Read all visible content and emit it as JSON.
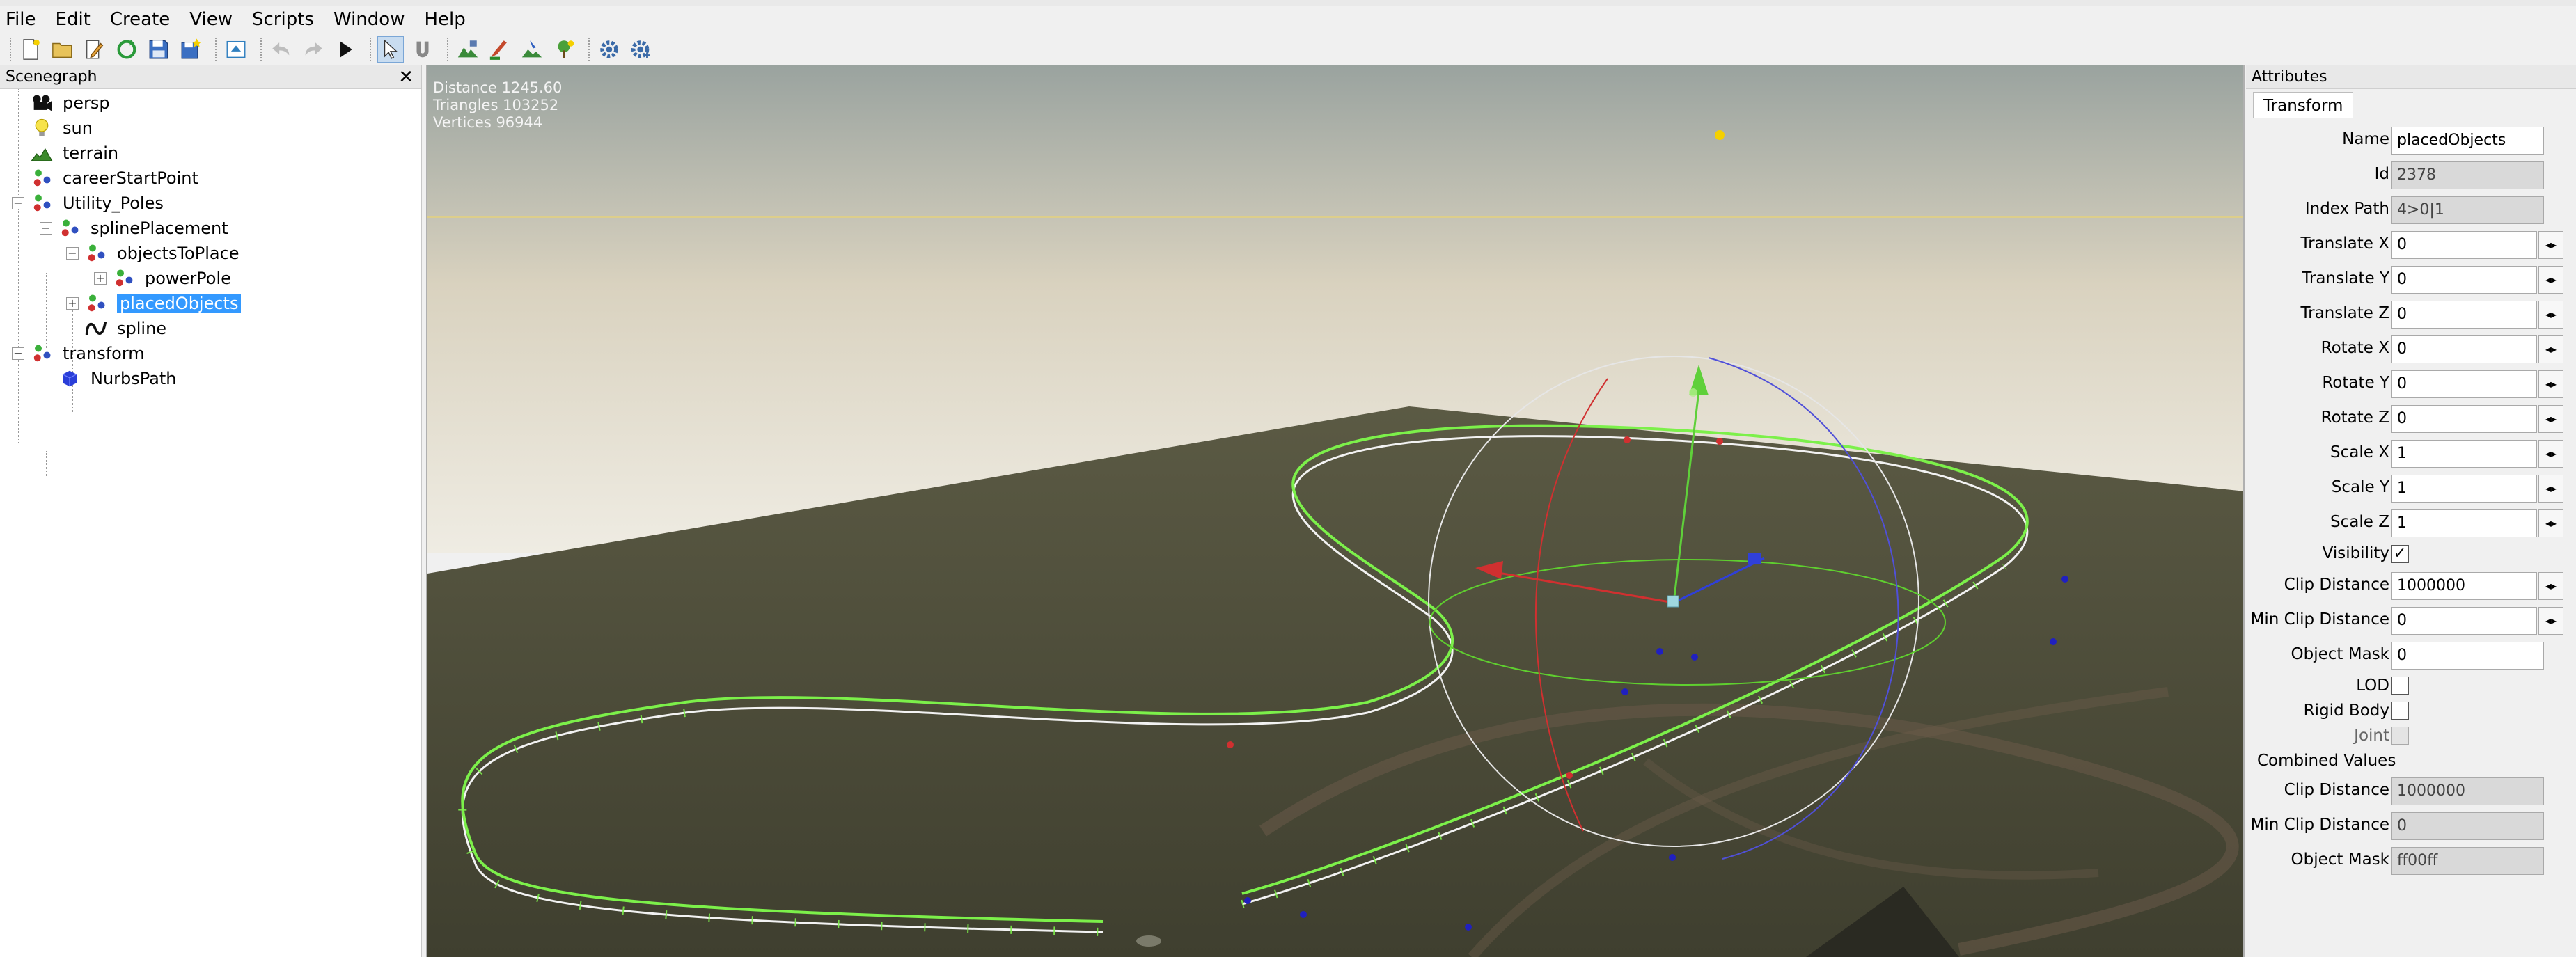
{
  "menu": [
    "File",
    "Edit",
    "Create",
    "View",
    "Scripts",
    "Window",
    "Help"
  ],
  "menu_accel": [
    "F",
    "E",
    "C",
    "V",
    "S",
    "W",
    "H"
  ],
  "scenegraph": {
    "title": "Scenegraph",
    "close": "✕",
    "items": [
      {
        "label": "persp",
        "icon": "camera-icon"
      },
      {
        "label": "sun",
        "icon": "lightbulb-icon"
      },
      {
        "label": "terrain",
        "icon": "terrain-icon"
      },
      {
        "label": "careerStartPoint",
        "icon": "transform-node-icon"
      },
      {
        "label": "Utility_Poles",
        "icon": "transform-node-icon"
      },
      {
        "label": "splinePlacement",
        "icon": "transform-node-icon"
      },
      {
        "label": "objectsToPlace",
        "icon": "transform-node-icon"
      },
      {
        "label": "powerPole",
        "icon": "transform-node-icon"
      },
      {
        "label": "placedObjects",
        "icon": "transform-node-icon",
        "selected": true
      },
      {
        "label": "spline",
        "icon": "spline-icon"
      },
      {
        "label": "transform",
        "icon": "transform-node-icon"
      },
      {
        "label": "NurbsPath",
        "icon": "cube-icon"
      }
    ]
  },
  "viewport": {
    "stats": {
      "distance": "Distance 1245.60",
      "triangles": "Triangles 103252",
      "vertices": "Vertices 96944"
    }
  },
  "attributes": {
    "title": "Attributes",
    "tab": "Transform",
    "fields": {
      "name": {
        "label": "Name",
        "value": "placedObjects"
      },
      "id": {
        "label": "Id",
        "value": "2378"
      },
      "index_path": {
        "label": "Index Path",
        "value": "4>0|1"
      },
      "translate_x": {
        "label": "Translate X",
        "value": "0"
      },
      "translate_y": {
        "label": "Translate Y",
        "value": "0"
      },
      "translate_z": {
        "label": "Translate Z",
        "value": "0"
      },
      "rotate_x": {
        "label": "Rotate X",
        "value": "0"
      },
      "rotate_y": {
        "label": "Rotate Y",
        "value": "0"
      },
      "rotate_z": {
        "label": "Rotate Z",
        "value": "0"
      },
      "scale_x": {
        "label": "Scale X",
        "value": "1"
      },
      "scale_y": {
        "label": "Scale Y",
        "value": "1"
      },
      "scale_z": {
        "label": "Scale Z",
        "value": "1"
      },
      "visibility": {
        "label": "Visibility",
        "checked": true
      },
      "clip_distance": {
        "label": "Clip Distance",
        "value": "1000000"
      },
      "min_clip_distance": {
        "label": "Min Clip Distance",
        "value": "0"
      },
      "object_mask": {
        "label": "Object Mask",
        "value": "0"
      },
      "lod": {
        "label": "LOD",
        "checked": false
      },
      "rigid_body": {
        "label": "Rigid Body",
        "checked": false
      },
      "joint": {
        "label": "Joint",
        "checked": false
      }
    },
    "combined": {
      "title": "Combined Values",
      "clip_distance": {
        "label": "Clip Distance",
        "value": "1000000"
      },
      "min_clip_distance": {
        "label": "Min Clip Distance",
        "value": "0"
      },
      "object_mask": {
        "label": "Object Mask",
        "value": "ff00ff"
      }
    },
    "spin_glyph": "◂▸",
    "check_glyph": "✓"
  }
}
